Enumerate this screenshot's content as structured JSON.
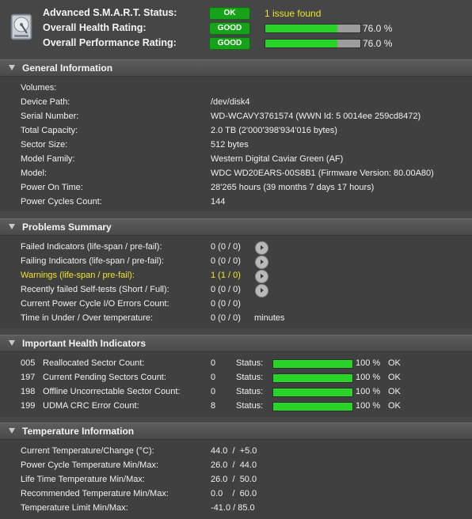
{
  "top": {
    "smart_label": "Advanced S.M.A.R.T. Status:",
    "smart_badge": "OK",
    "smart_issue": "1 issue found",
    "health_label": "Overall Health Rating:",
    "health_badge": "GOOD",
    "health_fill": 0.76,
    "health_pct": "76.0 %",
    "perf_label": "Overall Performance Rating:",
    "perf_badge": "GOOD",
    "perf_fill": 0.76,
    "perf_pct": "76.0 %"
  },
  "general": {
    "title": "General Information",
    "rows": [
      {
        "label": "Volumes:",
        "value": ""
      },
      {
        "label": "Device Path:",
        "value": "/dev/disk4"
      },
      {
        "label": "Serial Number:",
        "value": "WD-WCAVY3761574 (WWN Id: 5 0014ee 259cd8472)"
      },
      {
        "label": "Total Capacity:",
        "value": "2.0 TB (2'000'398'934'016 bytes)"
      },
      {
        "label": "Sector Size:",
        "value": "512 bytes"
      },
      {
        "label": "Model Family:",
        "value": "Western Digital Caviar Green (AF)"
      },
      {
        "label": "Model:",
        "value": "WDC WD20EARS-00S8B1  (Firmware Version: 80.00A80)"
      },
      {
        "label": "Power On Time:",
        "value": "28'265 hours (39 months 7 days 17 hours)"
      },
      {
        "label": "Power Cycles Count:",
        "value": "144"
      }
    ]
  },
  "problems": {
    "title": "Problems Summary",
    "rows": [
      {
        "label": "Failed Indicators (life-span / pre-fail):",
        "value": "0 (0 / 0)"
      },
      {
        "label": "Failing Indicators (life-span / pre-fail):",
        "value": "0 (0 / 0)"
      },
      {
        "label": "Warnings (life-span / pre-fail):",
        "value": "1 (1 / 0)"
      },
      {
        "label": "Recently failed Self-tests (Short / Full):",
        "value": "0 (0 / 0)"
      },
      {
        "label": "Current Power Cycle I/O Errors Count:",
        "value": "0 (0 / 0)"
      },
      {
        "label": "Time in Under / Over temperature:",
        "value": "0 (0 / 0)",
        "unit": "minutes"
      }
    ]
  },
  "health": {
    "title": "Important Health Indicators",
    "status_label": "Status:",
    "rows": [
      {
        "id": "005",
        "name": "Reallocated Sector Count:",
        "value": "0",
        "fill": 1.0,
        "pct": "100 %",
        "state": "OK"
      },
      {
        "id": "197",
        "name": "Current Pending Sectors Count:",
        "value": "0",
        "fill": 1.0,
        "pct": "100 %",
        "state": "OK"
      },
      {
        "id": "198",
        "name": "Offline Uncorrectable Sector Count:",
        "value": "0",
        "fill": 1.0,
        "pct": "100 %",
        "state": "OK"
      },
      {
        "id": "199",
        "name": "UDMA CRC Error Count:",
        "value": "8",
        "fill": 1.0,
        "pct": "100 %",
        "state": "OK"
      }
    ]
  },
  "temperature": {
    "title": "Temperature Information",
    "rows": [
      {
        "label": "Current Temperature/Change (°C):",
        "value": "44.0  /  +5.0"
      },
      {
        "label": "Power Cycle Temperature Min/Max:",
        "value": "26.0  /  44.0"
      },
      {
        "label": "Life Time Temperature Min/Max:",
        "value": "26.0  /  50.0"
      },
      {
        "label": "Recommended Temperature Min/Max:",
        "value": "0.0    /  60.0"
      },
      {
        "label": "Temperature Limit Min/Max:",
        "value": "-41.0 / 85.0"
      }
    ]
  },
  "colors": {
    "ok_green": "#16a31a",
    "bar_fill": "#27d427",
    "warning_yellow": "#f0e42a"
  },
  "icons": {
    "disk": "hard-disk-icon",
    "expand": "disclosure-triangle-icon",
    "detail": "arrow-right-circle-icon"
  }
}
